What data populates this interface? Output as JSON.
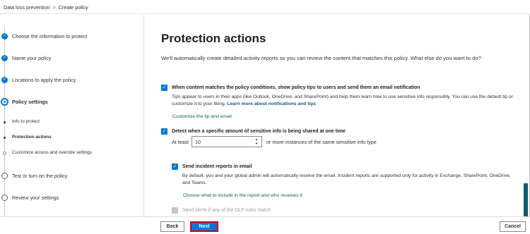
{
  "breadcrumb": {
    "root": "Data loss prevention",
    "separator": ">",
    "current": "Create policy"
  },
  "steps": [
    {
      "label": "Choose the information to protect",
      "state": "done"
    },
    {
      "label": "Name your policy",
      "state": "done"
    },
    {
      "label": "Locations to apply the policy",
      "state": "done"
    },
    {
      "label": "Policy settings",
      "state": "current"
    },
    {
      "label": "Info to protect",
      "state": "sub-done"
    },
    {
      "label": "Protection actions",
      "state": "sub-current"
    },
    {
      "label": "Customize access and override settings",
      "state": "sub-todo"
    },
    {
      "label": "Test or turn on the policy",
      "state": "todo"
    },
    {
      "label": "Review your settings",
      "state": "todo"
    }
  ],
  "main": {
    "title": "Protection actions",
    "intro": "We'll automatically create detailed activity reports so you can review the content that matches this policy. What else do you want to do?",
    "option1": {
      "checked": true,
      "title": "When content matches the policy conditions, show policy tips to users and send them an email notification",
      "desc": "Tips appear to users in their apps (like Outlook, OneDrive, and SharePoint) and help them learn how to use sensitive info responsibly. You can use the default tip or customize it to your liking.",
      "learn_link": "Learn more about notifications and tips",
      "customize_link": "Customize the tip and email"
    },
    "option2": {
      "checked": true,
      "title": "Detect when a specific amount of sensitive info is being shared at one time",
      "at_least_label": "At least",
      "count_value": "10",
      "after_label": "or more instances of the same sensitive info type"
    },
    "option3": {
      "checked": true,
      "title": "Send incident reports in email",
      "desc": "By default, you and your global admin will automatically receive the email. Incident reports are supported only for activity in Exchange, SharePoint, OneDrive, and Teams.",
      "link": "Choose what to include in the report and who receives it"
    },
    "option4": {
      "checked": false,
      "title": "Send alerts if any of the DLP rules match"
    }
  },
  "footer": {
    "back": "Back",
    "next": "Next",
    "cancel": "Cancel"
  },
  "colors": {
    "accent": "#0078d4",
    "link": "#0f5d68",
    "highlight": "#e00000"
  },
  "icons": {
    "check": "check-icon",
    "chevron": "chevron-right-icon"
  }
}
